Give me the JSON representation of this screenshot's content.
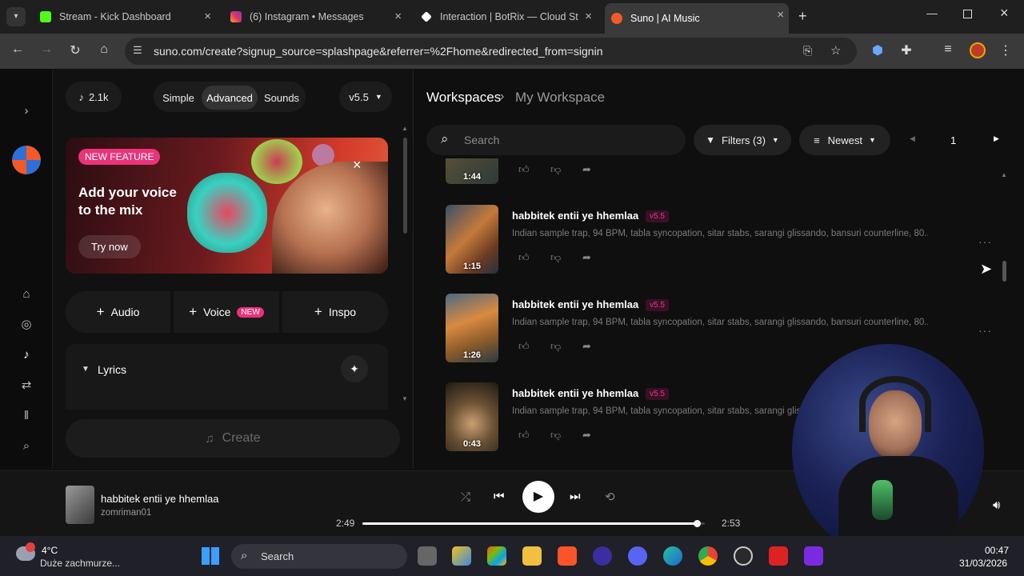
{
  "tabs": [
    {
      "title": "Stream - Kick Dashboard",
      "color": "#53fc18"
    },
    {
      "title": "(6) Instagram • Messages",
      "color": "#e1306c"
    },
    {
      "title": "Interaction | BotRix — Cloud St",
      "color": "#ffffff"
    },
    {
      "title": "Suno | AI Music",
      "color": "#f25a2a"
    }
  ],
  "url": "suno.com/create?signup_source=splashpage&referrer=%2Fhome&redirected_from=signin",
  "create": {
    "credits": "2.1k",
    "modes": [
      "Simple",
      "Advanced",
      "Sounds"
    ],
    "version": "v5.5",
    "banner": {
      "badge": "NEW FEATURE",
      "headline": "Add your voice to the mix",
      "cta": "Try now"
    },
    "add_audio": "Audio",
    "add_voice": "Voice",
    "voice_badge": "NEW",
    "add_inspo": "Inspo",
    "lyrics_label": "Lyrics",
    "create_label": "Create"
  },
  "library": {
    "crumb_root": "Workspaces",
    "crumb_current": "My Workspace",
    "search_placeholder": "Search",
    "filters": "Filters (3)",
    "sort": "Newest",
    "page": "1",
    "partial_duration": "1:44",
    "songs": [
      {
        "title": "habbitek entii ye hhemlaa",
        "version": "v5.5",
        "desc": "Indian sample trap, 94 BPM, tabla syncopation, sitar stabs, sarangi glissando, bansuri counterline, 80...",
        "duration": "1:15"
      },
      {
        "title": "habbitek entii ye hhemlaa",
        "version": "v5.5",
        "desc": "Indian sample trap, 94 BPM, tabla syncopation, sitar stabs, sarangi glissando, bansuri counterline, 80...",
        "duration": "1:26"
      },
      {
        "title": "habbitek entii ye hhemlaa",
        "version": "v5.5",
        "desc": "Indian sample trap, 94 BPM, tabla syncopation, sitar stabs, sarangi glissando, bansuri counterline, 80...",
        "duration": "0:43"
      }
    ]
  },
  "player": {
    "title": "habbitek entii ye hhemlaa",
    "artist": "zomriman01",
    "elapsed": "2:49",
    "total": "2:53",
    "progress": 0.977
  },
  "taskbar": {
    "weather_temp": "4°C",
    "weather_desc": "Duże zachmurze...",
    "search": "Search",
    "time": "00:47",
    "date": "31/03/2026"
  }
}
